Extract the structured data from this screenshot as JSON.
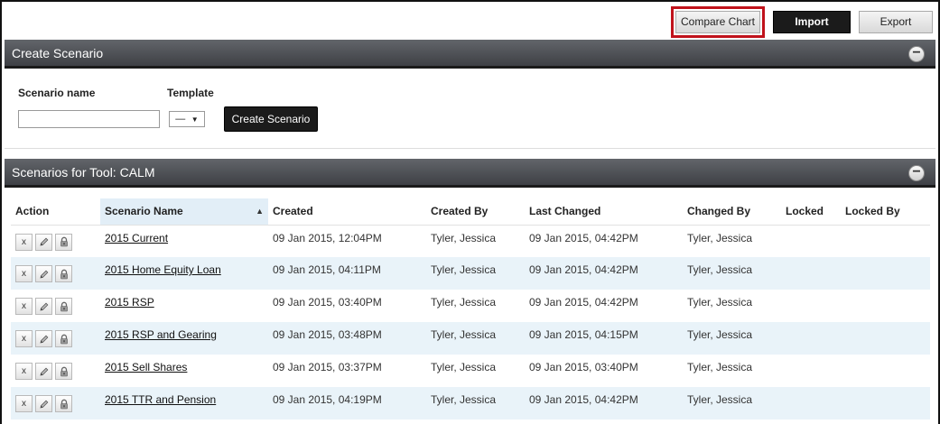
{
  "toolbar": {
    "compare_label": "Compare Chart",
    "import_label": "Import",
    "export_label": "Export"
  },
  "create_section": {
    "title": "Create Scenario",
    "collapse_symbol": "−",
    "scenario_name_label": "Scenario name",
    "scenario_name_value": "",
    "template_label": "Template",
    "template_selected": "—",
    "create_button_label": "Create Scenario"
  },
  "scenarios_section": {
    "title": "Scenarios for Tool: CALM",
    "collapse_symbol": "−",
    "columns": [
      "Action",
      "Scenario Name",
      "Created",
      "Created By",
      "Last Changed",
      "Changed By",
      "Locked",
      "Locked By"
    ],
    "sort_indicator": "▲",
    "rows": [
      {
        "name": "2015 Current",
        "created": "09 Jan 2015, 12:04PM",
        "created_by": "Tyler, Jessica",
        "last_changed": "09 Jan 2015, 04:42PM",
        "changed_by": "Tyler, Jessica",
        "locked": "",
        "locked_by": ""
      },
      {
        "name": "2015 Home Equity Loan",
        "created": "09 Jan 2015, 04:11PM",
        "created_by": "Tyler, Jessica",
        "last_changed": "09 Jan 2015, 04:42PM",
        "changed_by": "Tyler, Jessica",
        "locked": "",
        "locked_by": ""
      },
      {
        "name": "2015 RSP",
        "created": "09 Jan 2015, 03:40PM",
        "created_by": "Tyler, Jessica",
        "last_changed": "09 Jan 2015, 04:42PM",
        "changed_by": "Tyler, Jessica",
        "locked": "",
        "locked_by": ""
      },
      {
        "name": "2015 RSP and Gearing",
        "created": "09 Jan 2015, 03:48PM",
        "created_by": "Tyler, Jessica",
        "last_changed": "09 Jan 2015, 04:15PM",
        "changed_by": "Tyler, Jessica",
        "locked": "",
        "locked_by": ""
      },
      {
        "name": "2015 Sell Shares",
        "created": "09 Jan 2015, 03:37PM",
        "created_by": "Tyler, Jessica",
        "last_changed": "09 Jan 2015, 03:40PM",
        "changed_by": "Tyler, Jessica",
        "locked": "",
        "locked_by": ""
      },
      {
        "name": "2015 TTR and Pension",
        "created": "09 Jan 2015, 04:19PM",
        "created_by": "Tyler, Jessica",
        "last_changed": "09 Jan 2015, 04:42PM",
        "changed_by": "Tyler, Jessica",
        "locked": "",
        "locked_by": ""
      }
    ],
    "row_actions": {
      "delete_symbol": "x",
      "edit_icon": "pencil-icon",
      "lock_icon": "lock-icon"
    }
  },
  "colors": {
    "highlight_border": "#c0121b",
    "header_bar": "#4a4c50",
    "alt_row": "#e9f3f9"
  }
}
